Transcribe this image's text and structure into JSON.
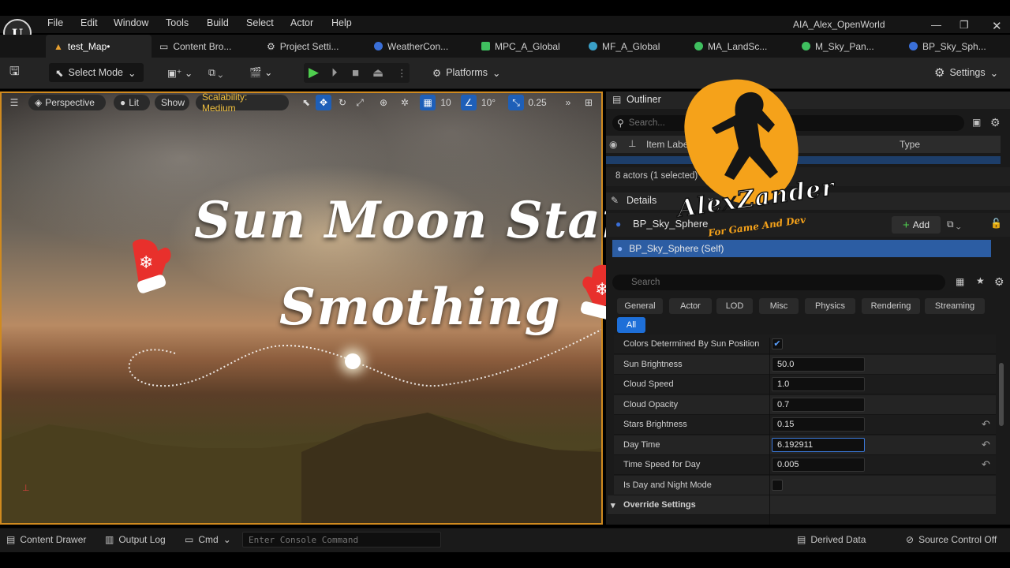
{
  "menu": [
    "File",
    "Edit",
    "Window",
    "Tools",
    "Build",
    "Select",
    "Actor",
    "Help"
  ],
  "project_name": "AIA_Alex_OpenWorld",
  "tabs": [
    {
      "label": "test_Map•",
      "icon": "level-icon",
      "color": "#e8a030"
    },
    {
      "label": "Content Bro...",
      "icon": "folder-icon",
      "color": "#bbbbbb"
    },
    {
      "label": "Project Setti...",
      "icon": "gear-icon",
      "color": "#bbbbbb"
    },
    {
      "label": "WeatherCon...",
      "icon": "blueprint-icon",
      "color": "#3a6fd8"
    },
    {
      "label": "MPC_A_Global",
      "icon": "collection-icon",
      "color": "#3fbf5f"
    },
    {
      "label": "MF_A_Global",
      "icon": "function-icon",
      "color": "#3aa0c8"
    },
    {
      "label": "MA_LandSc...",
      "icon": "material-icon",
      "color": "#3fbf5f"
    },
    {
      "label": "M_Sky_Pan...",
      "icon": "material-icon",
      "color": "#3fbf5f"
    },
    {
      "label": "BP_Sky_Sph...",
      "icon": "blueprint-icon",
      "color": "#3a6fd8"
    }
  ],
  "toolbar": {
    "select_mode": "Select Mode",
    "platforms": "Platforms",
    "settings": "Settings"
  },
  "viewport": {
    "perspective": "Perspective",
    "lit": "Lit",
    "show": "Show",
    "scalability": "Scalability: Medium",
    "grid_snap": "10",
    "rot_snap": "10°",
    "scale_snap": "0.25"
  },
  "overlay": {
    "line1": "Sun Moon Stars",
    "line2": "Smothing"
  },
  "logo": {
    "name": "AlexZander",
    "tagline": "For Game And Dev"
  },
  "outliner": {
    "title": "Outliner",
    "search_placeholder": "Search...",
    "col_label": "Item Label",
    "col_type": "Type",
    "status": "8 actors (1 selected)"
  },
  "details": {
    "title": "Details",
    "actor": "BP_Sky_Sphere",
    "add": "Add",
    "component": "BP_Sky_Sphere (Self)",
    "search_placeholder": "Search",
    "categories": [
      "General",
      "Actor",
      "LOD",
      "Misc",
      "Physics",
      "Rendering",
      "Streaming",
      "All"
    ],
    "properties": [
      {
        "label": "Colors Determined By Sun Position",
        "type": "check",
        "checked": true
      },
      {
        "label": "Sun Brightness",
        "value": "50.0"
      },
      {
        "label": "Cloud Speed",
        "value": "1.0"
      },
      {
        "label": "Cloud Opacity",
        "value": "0.7"
      },
      {
        "label": "Stars Brightness",
        "value": "0.15",
        "reset": true
      },
      {
        "label": "Day Time",
        "value": "6.192911",
        "reset": true,
        "active": true
      },
      {
        "label": "Time Speed for Day",
        "value": "0.005",
        "reset": true
      },
      {
        "label": "Is Day and Night Mode",
        "type": "check",
        "checked": false
      }
    ],
    "section": "Override Settings"
  },
  "bottom": {
    "content_drawer": "Content Drawer",
    "output_log": "Output Log",
    "cmd": "Cmd",
    "console_placeholder": "Enter Console Command",
    "derived_data": "Derived Data",
    "source_control": "Source Control Off"
  }
}
